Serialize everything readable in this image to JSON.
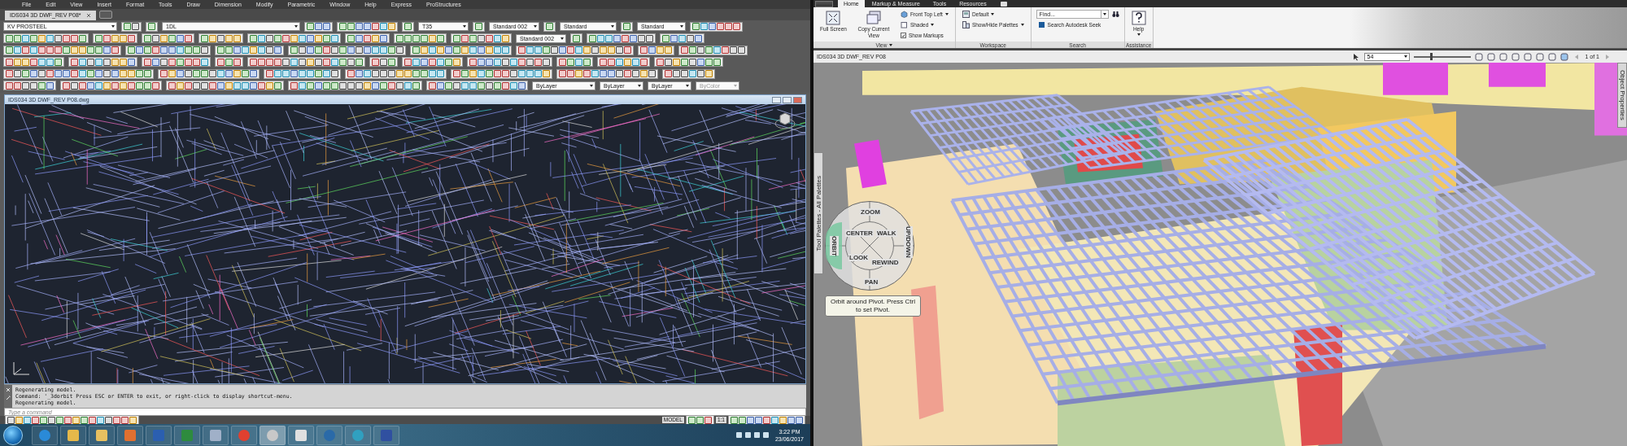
{
  "autocad": {
    "menu": [
      "File",
      "Edit",
      "View",
      "Insert",
      "Format",
      "Tools",
      "Draw",
      "Dimension",
      "Modify",
      "Parametric",
      "Window",
      "Help",
      "Express",
      "ProStructures"
    ],
    "doc_tabs": [
      {
        "label": "IDS034 3D DWF_REV P08*",
        "selected": true
      }
    ],
    "toolbar_dropdowns": [
      {
        "value": "KV PROSTEEL",
        "disabled": false
      },
      {
        "value": "1DL",
        "disabled": false
      },
      {
        "value": "T35",
        "disabled": false
      },
      {
        "value": "Standard 002",
        "disabled": false
      },
      {
        "value": "Standard",
        "disabled": false
      },
      {
        "value": "Standard",
        "disabled": false
      },
      {
        "value": "Standard 002",
        "disabled": false
      },
      {
        "value": "ByLayer",
        "disabled": false
      },
      {
        "value": "ByLayer",
        "disabled": false
      },
      {
        "value": "ByLayer",
        "disabled": false
      },
      {
        "value": "ByColor",
        "disabled": true
      }
    ],
    "drawing_window": {
      "title": "IDS034 3D DWF_REV P08.dwg"
    },
    "command_history": [
      "Regenerating model.",
      "Command: '_3dorbit Press ESC or ENTER to exit, or right-click to display shortcut-menu.",
      "Regenerating model."
    ],
    "command_line": {
      "placeholder": "Type a command"
    },
    "status_bar": {
      "space": "MODEL",
      "scale": "1:1"
    }
  },
  "taskbar": {
    "time": "3:22 PM",
    "date": "23/06/2017"
  },
  "design_review": {
    "ribbon_tabs": [
      {
        "label": "Home",
        "selected": true
      },
      {
        "label": "Markup & Measure",
        "selected": false
      },
      {
        "label": "Tools",
        "selected": false
      },
      {
        "label": "Resources",
        "selected": false
      }
    ],
    "groups": [
      {
        "label": "View",
        "has_menu": true,
        "items": [
          {
            "kind": "large",
            "label": "Full Screen"
          },
          {
            "kind": "large",
            "label": "Copy Current View"
          },
          {
            "kind": "dropdown",
            "label": "Front Top Left"
          },
          {
            "kind": "dropdown",
            "label": "Shaded"
          },
          {
            "kind": "checkbox",
            "label": "Show Markups",
            "checked": true
          }
        ]
      },
      {
        "label": "Workspace",
        "has_menu": false,
        "items": [
          {
            "kind": "dropdown",
            "label": "Default"
          },
          {
            "kind": "dropdown",
            "label": "Show/Hide Palettes"
          }
        ]
      },
      {
        "label": "Search",
        "has_menu": false,
        "items": [
          {
            "kind": "search",
            "placeholder": "Find..."
          },
          {
            "kind": "small",
            "label": "Search Autodesk Seek"
          }
        ]
      },
      {
        "label": "Assistance",
        "has_menu": false,
        "items": [
          {
            "kind": "large_dropdown",
            "label": "Help"
          }
        ]
      }
    ],
    "document_title": "IDS034 3D DWF_REV P08",
    "zoom": "54",
    "zoom_slider": {
      "level": 0.3
    },
    "page": "1 of 1",
    "palette_strip": "Tool Palettes - All Palettes",
    "properties_strip": "Object Properties",
    "nav_wheel": {
      "wedges": [
        "ZOOM",
        "ORBIT",
        "CENTER",
        "WALK",
        "LOOK",
        "REWIND",
        "PAN",
        "UP/DOWN"
      ],
      "tooltip": "Orbit around Pivot. Press Ctrl to set Pivot."
    }
  }
}
